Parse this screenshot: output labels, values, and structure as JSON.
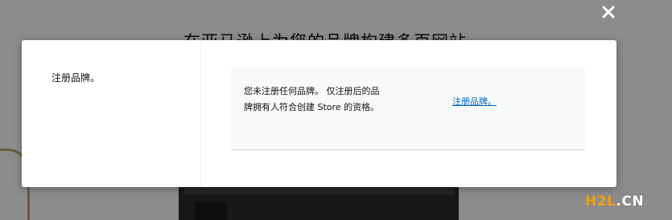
{
  "backdrop": {
    "title": "在亚马逊上为您的品牌构建多页网站"
  },
  "modal": {
    "side_label": "注册品牌。",
    "info_text": "您未注册任何品牌。 仅注册后的品牌拥有人符合创建 Store 的资格。",
    "register_link": "注册品牌。"
  },
  "close_icon": "close-icon",
  "watermark": {
    "part_a": "H2L",
    "part_b": ".CN"
  },
  "colors": {
    "link": "#0066c0",
    "info_box_bg": "#f8fafa",
    "watermark_orange": "#e8a217"
  }
}
